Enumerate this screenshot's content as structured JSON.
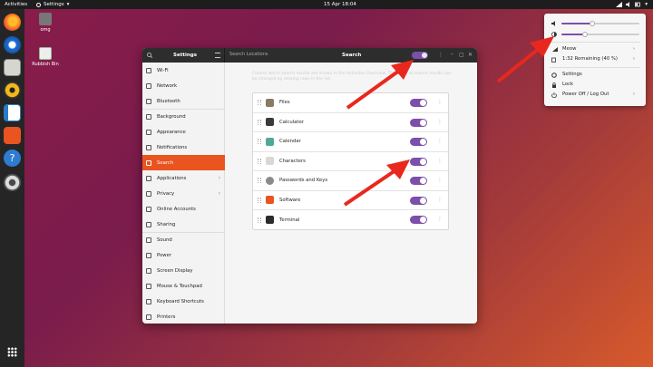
{
  "topbar": {
    "activities": "Activities",
    "app_menu": "Settings",
    "clock": "15 Apr  18:04"
  },
  "desktop": {
    "icons": [
      {
        "label": "omg",
        "icon": "folder-home-icon"
      },
      {
        "label": "Rubbish Bin",
        "icon": "trash-icon"
      }
    ]
  },
  "dock": {
    "items": [
      "firefox-icon",
      "thunderbird-icon",
      "files-icon",
      "rhythmbox-icon",
      "writer-icon",
      "software-icon",
      "help-icon",
      "settings-icon"
    ],
    "grid_icon": "show-apps-icon"
  },
  "window": {
    "left_title": "Settings",
    "search_placeholder": "Search Locations",
    "right_title": "Search",
    "description": "Control which search results are shown in the Activities Overview. The order of search results can be changed by moving rows in the list."
  },
  "sidebar": {
    "items": [
      {
        "label": "Wi-Fi",
        "icon": "wifi-icon"
      },
      {
        "label": "Network",
        "icon": "network-icon"
      },
      {
        "label": "Bluetooth",
        "icon": "bluetooth-icon"
      },
      {
        "label": "Background",
        "icon": "background-icon"
      },
      {
        "label": "Appearance",
        "icon": "appearance-icon"
      },
      {
        "label": "Notifications",
        "icon": "bell-icon"
      },
      {
        "label": "Search",
        "icon": "search-icon",
        "active": true
      },
      {
        "label": "Applications",
        "icon": "apps-icon",
        "arrow": true
      },
      {
        "label": "Privacy",
        "icon": "privacy-icon",
        "arrow": true
      },
      {
        "label": "Online Accounts",
        "icon": "accounts-icon"
      },
      {
        "label": "Sharing",
        "icon": "share-icon"
      },
      {
        "label": "Sound",
        "icon": "sound-icon"
      },
      {
        "label": "Power",
        "icon": "power-icon"
      },
      {
        "label": "Screen Display",
        "icon": "display-icon"
      },
      {
        "label": "Mouse & Touchpad",
        "icon": "mouse-icon"
      },
      {
        "label": "Keyboard Shortcuts",
        "icon": "keyboard-icon"
      },
      {
        "label": "Printers",
        "icon": "printer-icon"
      }
    ]
  },
  "search_providers": [
    {
      "label": "Files",
      "icon": "files-icon",
      "color": "#8a7a64",
      "enabled": true
    },
    {
      "label": "Calculator",
      "icon": "calculator-icon",
      "color": "#3a3a3a",
      "enabled": true
    },
    {
      "label": "Calendar",
      "icon": "calendar-icon",
      "color": "#4fa89a",
      "enabled": true
    },
    {
      "label": "Characters",
      "icon": "characters-icon",
      "color": "#d8d8d8",
      "enabled": true
    },
    {
      "label": "Passwords and Keys",
      "icon": "keys-icon",
      "color": "#8a8a8a",
      "enabled": true
    },
    {
      "label": "Software",
      "icon": "software-icon",
      "color": "#e95420",
      "enabled": true
    },
    {
      "label": "Terminal",
      "icon": "terminal-icon",
      "color": "#2c2c2c",
      "enabled": true
    }
  ],
  "popup": {
    "volume_level": 0.4,
    "brightness_level": 0.3,
    "items": [
      {
        "label": "Meow",
        "icon": "wifi-icon",
        "arrow": true
      },
      {
        "label": "1:32 Remaining (40 %)",
        "icon": "battery-icon",
        "arrow": true
      },
      {
        "label": "Settings",
        "icon": "gear-icon"
      },
      {
        "label": "Lock",
        "icon": "lock-icon"
      },
      {
        "label": "Power Off / Log Out",
        "icon": "power-icon",
        "arrow": true
      }
    ]
  },
  "colors": {
    "accent": "#e95420",
    "toggle_on": "#7b4faa",
    "arrow": "#e8281e"
  }
}
